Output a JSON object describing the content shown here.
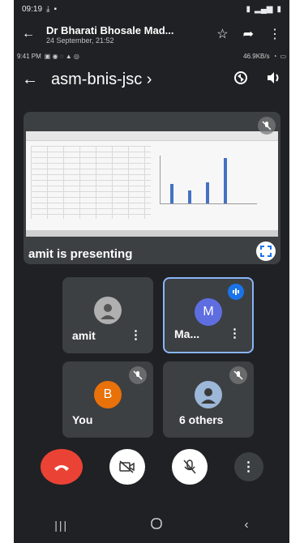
{
  "statusbar": {
    "time": "09:19"
  },
  "appbar": {
    "title": "Dr Bharati Bhosale Mad...",
    "subtitle": "24 September, 21:52"
  },
  "innerbar": {
    "time": "9:41 PM",
    "speed": "46.9KB/s"
  },
  "meeting": {
    "title": "asm-bnis-jsc ›"
  },
  "present": {
    "label": "amit is presenting"
  },
  "participants": [
    {
      "name": "amit",
      "avatar": ""
    },
    {
      "name": "Ma...",
      "avatar": "M",
      "color": "#5e6ee0"
    },
    {
      "name": "You",
      "avatar": "B",
      "color": "#e8710a"
    },
    {
      "name": "6 others",
      "avatar": ""
    }
  ],
  "colors": {
    "end_call": "#ea4335",
    "tile": "#3c4043",
    "active_border": "#8ab4f8"
  }
}
